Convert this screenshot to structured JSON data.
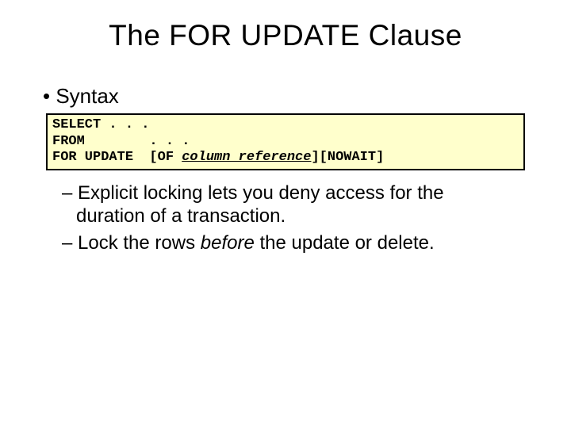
{
  "title": "The FOR UPDATE Clause",
  "syntax_label": "• Syntax",
  "code": {
    "line1": "SELECT . . .",
    "line2": "FROM        . . .",
    "line3_a": "FOR UPDATE  [OF ",
    "line3_ref": "column_reference",
    "line3_b": "][NOWAIT]"
  },
  "points": {
    "p1_a": "– Explicit locking lets you deny access for the duration of a transaction.",
    "p2_a": "– Lock the rows ",
    "p2_em": "before",
    "p2_b": " the update or delete."
  }
}
